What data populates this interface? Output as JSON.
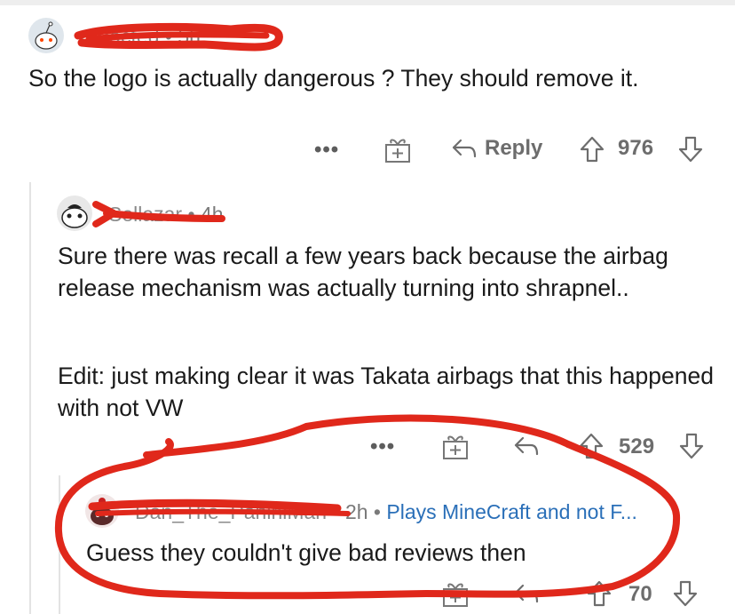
{
  "comments": [
    {
      "username": "redacted",
      "age": "5h",
      "body": "So the logo is actually dangerous ? They should remove it.",
      "more_label": "•••",
      "reply_label": "Reply",
      "votes": "976"
    },
    {
      "username": "Sellazar",
      "age": "4h",
      "body_1": "Sure there was recall a few years back because the airbag release mechanism was actually turning into shrapnel..",
      "body_2": "Edit: just making clear it was Takata airbags that this happened with not VW",
      "more_label": "•••",
      "votes": "529"
    },
    {
      "username": "Dan_The_PaniniMan",
      "age": "2h",
      "flair": "Plays MineCraft and not F...",
      "body": "Guess they couldn't give bad reviews then",
      "more_label": "•••",
      "votes": "70"
    }
  ],
  "separator": "•",
  "colors": {
    "annotation": "#e0281b",
    "text": "#1a1a1a",
    "meta": "#7a7a7a",
    "flair": "#2a6fb8"
  }
}
